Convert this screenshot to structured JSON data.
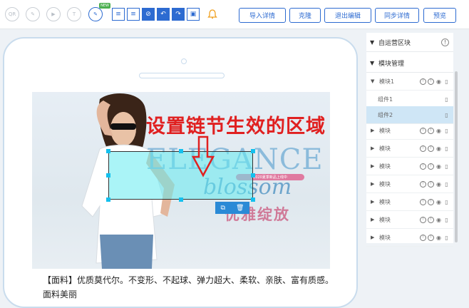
{
  "toolbar": {
    "new_badge": "NEW",
    "buttons": [
      {
        "label": "导入详情"
      },
      {
        "label": "克隆"
      },
      {
        "label": "退出编辑"
      },
      {
        "label": "同步详情"
      },
      {
        "label": "预览"
      }
    ],
    "icons": [
      "qr-icon",
      "edit-link-icon",
      "video-icon",
      "text-icon",
      "pen-icon",
      "align-top-icon",
      "align-bottom-icon",
      "compass-icon",
      "undo-icon",
      "redo-icon",
      "save-icon",
      "bell-icon"
    ]
  },
  "canvas": {
    "banner": {
      "headline": "ELEGANCE",
      "script": "blossom",
      "pill": "2020夏季新品上线中",
      "tagline": "优雅绽放"
    },
    "callout": "设置链节生效的区域",
    "description": "【面料】优质莫代尔。不变形、不起球、弹力超大、柔软、亲肤、富有质感。面料美丽"
  },
  "panel": {
    "sections": [
      {
        "label": "自运营区块"
      },
      {
        "label": "模块管理"
      }
    ],
    "modules": [
      {
        "label": "模块1",
        "expanded": true,
        "children": [
          {
            "label": "组件1"
          },
          {
            "label": "组件2",
            "selected": true
          }
        ]
      },
      {
        "label": "模块"
      },
      {
        "label": "模块"
      },
      {
        "label": "模块"
      },
      {
        "label": "模块"
      },
      {
        "label": "模块"
      },
      {
        "label": "模块"
      },
      {
        "label": "模块"
      }
    ]
  },
  "colors": {
    "accent": "#2d6bd1",
    "selection": "#64ebf0",
    "callout": "#e02020",
    "handle": "#14c0ee"
  }
}
